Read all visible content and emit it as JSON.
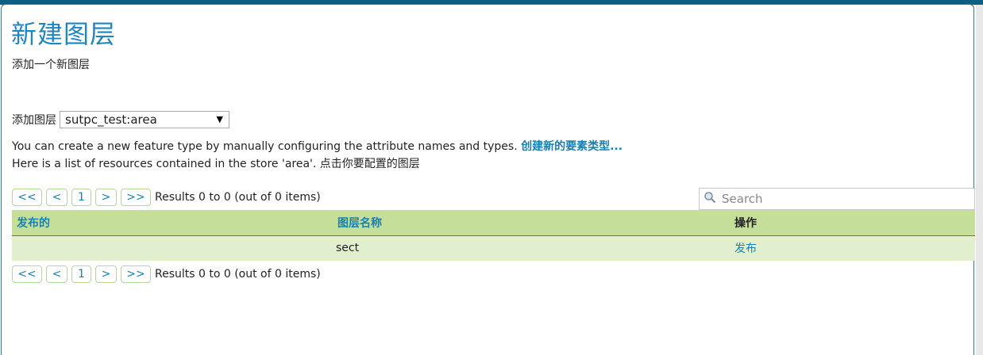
{
  "page": {
    "title": "新建图层",
    "subtitle": "添加一个新图层"
  },
  "add_layer": {
    "label": "添加图层",
    "selected_store": "sutpc_test:area"
  },
  "info": {
    "line1_text": "You can create a new feature type by manually configuring the attribute names and types. ",
    "line1_link": "创建新的要素类型...",
    "line2_text": "Here is a list of resources contained in the store 'area'. 点击你要配置的图层"
  },
  "pager": {
    "first": "<<",
    "prev": "<",
    "page": "1",
    "next": ">",
    "last": ">>",
    "results": "Results 0 to 0 (out of 0 items)"
  },
  "search": {
    "placeholder": "Search"
  },
  "table": {
    "headers": [
      "发布的",
      "图层名称",
      "操作"
    ],
    "rows": [
      {
        "published": "",
        "layer_name": "sect",
        "action": "发布"
      }
    ]
  },
  "colors": {
    "title_blue": "#1f86c1",
    "link_blue": "#1b7fae",
    "header_green": "#c5df9b",
    "row_green": "#e2efcf",
    "topbar": "#0a5f84"
  },
  "icons": {
    "search": "search-icon",
    "dropdown": "chevron-down-icon"
  }
}
